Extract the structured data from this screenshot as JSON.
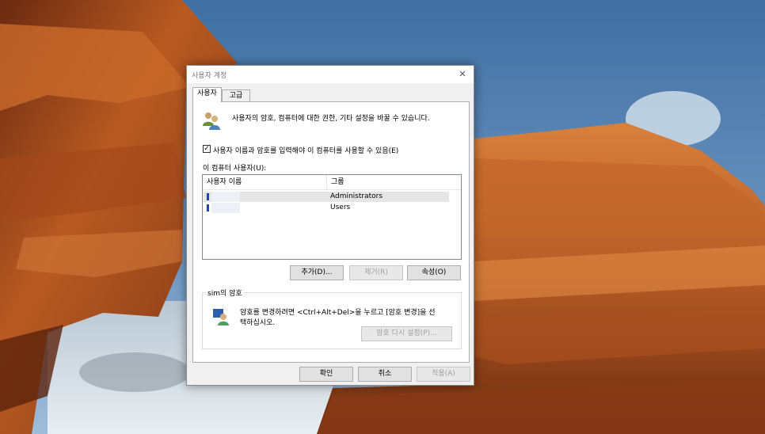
{
  "dialog": {
    "title": "사용자 계정",
    "close_glyph": "✕",
    "tabs": [
      {
        "label": "사용자"
      },
      {
        "label": "고급"
      }
    ],
    "intro_text": "사용자의 암호, 컴퓨터에 대한 권한, 기타 설정을 바꿀 수 있습니다.",
    "require_login_checkbox": {
      "checked": true,
      "glyph": "✓",
      "label": "사용자 이름과 암호를 입력해야 이 컴퓨터를 사용할 수 있음(E)"
    },
    "users_list": {
      "label": "이 컴퓨터 사용자(U):",
      "columns": [
        "사용자 이름",
        "그룹"
      ],
      "rows": [
        {
          "name": "",
          "group": "Administrators",
          "selected": true
        },
        {
          "name": "",
          "group": "Users",
          "selected": false
        }
      ]
    },
    "list_buttons": {
      "add": "추가(D)...",
      "remove": "제거(R)",
      "properties": "속성(O)"
    },
    "password_group": {
      "title": "sim의 암호",
      "text_line1": "암호를 변경하려면 <Ctrl+Alt+Del>을 누르고 [암호 변경]을 선",
      "text_line2": "택하십시오.",
      "reset_button": "암호 다시 설정(P)..."
    },
    "footer_buttons": {
      "ok": "확인",
      "cancel": "취소",
      "apply": "적용(A)"
    }
  }
}
